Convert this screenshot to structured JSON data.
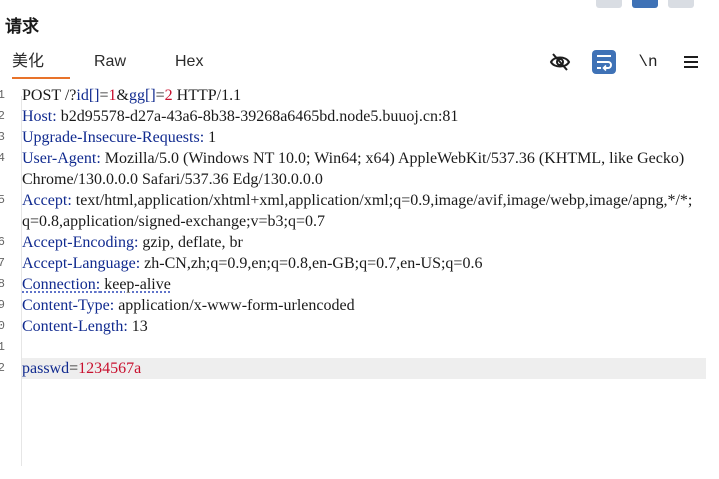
{
  "panel": {
    "title": "请求"
  },
  "tabs": [
    {
      "label": "美化",
      "active": true
    },
    {
      "label": "Raw",
      "active": false
    },
    {
      "label": "Hex",
      "active": false
    }
  ],
  "toolbar": {
    "hide_icon": "eye-off-icon",
    "pretty_icon": "word-wrap-icon",
    "newline_label": "\\n",
    "menu_icon": "hamburger-menu-icon"
  },
  "request": {
    "line_numbers": [
      "1",
      "2",
      "3",
      "4",
      "5",
      "6",
      "7",
      "8",
      "9",
      "0",
      "1",
      "2"
    ],
    "request_line": {
      "method": "POST /?",
      "p1": "id[]",
      "eq1": "=",
      "v1": "1",
      "amp": "&",
      "p2": "gg[]",
      "eq2": "=",
      "v2": "2",
      "proto": " HTTP/1.1"
    },
    "headers": [
      {
        "name": "Host",
        "value": " b2d95578-d27a-43a6-8b38-39268a6465bd.node5.buuoj.cn:81"
      },
      {
        "name": "Upgrade-Insecure-Requests",
        "value": " 1"
      },
      {
        "name": "User-Agent",
        "value": " Mozilla/5.0 (Windows NT 10.0; Win64; x64) AppleWebKit/537.36 (KHTML, like Gecko) Chrome/130.0.0.0 Safari/537.36 Edg/130.0.0.0"
      },
      {
        "name": "Accept",
        "value": " text/html,application/xhtml+xml,application/xml;q=0.9,image/avif,image/webp,image/apng,*/*;q=0.8,application/signed-exchange;v=b3;q=0.7"
      },
      {
        "name": "Accept-Encoding",
        "value": " gzip, deflate, br"
      },
      {
        "name": "Accept-Language",
        "value": " zh-CN,zh;q=0.9,en;q=0.8,en-GB;q=0.7,en-US;q=0.6"
      },
      {
        "name": "Connection",
        "value": " keep-alive"
      },
      {
        "name": "Content-Type",
        "value": " application/x-www-form-urlencoded"
      },
      {
        "name": "Content-Length",
        "value": " 13"
      }
    ],
    "body": {
      "param": "passwd",
      "eq": "=",
      "value": "1234567a"
    }
  },
  "colors": {
    "header_name": "#102a8f",
    "param_value": "#c8102e",
    "tab_underline": "#e8732a",
    "active_tool": "#3f72b6"
  }
}
